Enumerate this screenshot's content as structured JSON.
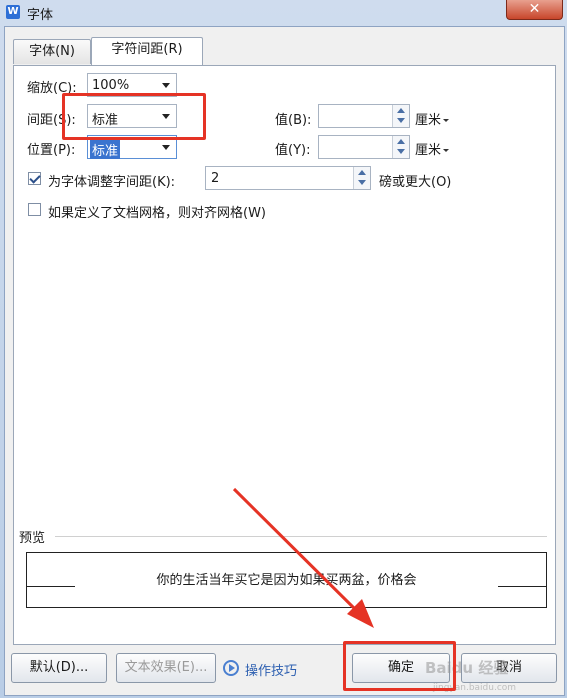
{
  "window": {
    "title": "字体",
    "close_glyph": "✕",
    "app_icon_letter": "W"
  },
  "tabs": [
    {
      "label": "字体(N)"
    },
    {
      "label": "字符间距(R)"
    }
  ],
  "scale": {
    "label": "缩放(C):",
    "value": "100%"
  },
  "spacing": {
    "label": "间距(S):",
    "value": "标准",
    "by_label": "值(B):",
    "by_value": "",
    "unit": "厘米"
  },
  "position": {
    "label": "位置(P):",
    "value": "标准",
    "by_label": "值(Y):",
    "by_value": "",
    "unit": "厘米"
  },
  "kerning": {
    "label": "为字体调整字间距(K):",
    "value": "2",
    "suffix": "磅或更大(O)",
    "checked": true
  },
  "snap_grid": {
    "label": "如果定义了文档网格，则对齐网格(W)",
    "checked": false
  },
  "preview": {
    "label": "预览",
    "sample_text": "你的生活当年买它是因为如果买两盆，价格会"
  },
  "buttons": {
    "default": "默认(D)...",
    "text_effects": "文本效果(E)...",
    "tips": "操作技巧",
    "ok": "确定",
    "cancel": "取消"
  },
  "watermark": {
    "text": "Baidu 经验",
    "sub": "jingyan.baidu.com"
  },
  "colors": {
    "annotation_red": "#e53325",
    "selection_blue": "#3b74cf"
  }
}
